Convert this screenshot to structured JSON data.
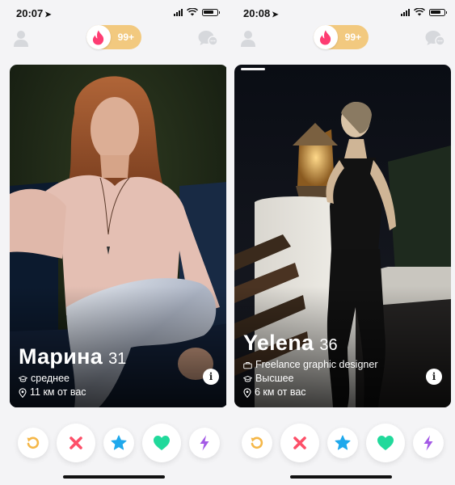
{
  "screens": [
    {
      "status_time": "20:07",
      "header": {
        "badge_count": "99+"
      },
      "card": {
        "name": "Марина",
        "age": "31",
        "details": [
          {
            "icon": "graduation-cap-icon",
            "text": "среднее"
          },
          {
            "icon": "location-pin-icon",
            "text": "11 км от вас"
          }
        ]
      }
    },
    {
      "status_time": "20:08",
      "header": {
        "badge_count": "99+"
      },
      "card": {
        "name": "Yelena",
        "age": "36",
        "details": [
          {
            "icon": "briefcase-icon",
            "text": "Freelance graphic designer"
          },
          {
            "icon": "graduation-cap-icon",
            "text": "Высшее"
          },
          {
            "icon": "location-pin-icon",
            "text": "6 км от вас"
          }
        ]
      }
    }
  ],
  "actions": [
    {
      "icon": "rewind-icon",
      "color": "#f5b748"
    },
    {
      "icon": "nope-x-icon",
      "color": "#fd4f68"
    },
    {
      "icon": "super-like-star-icon",
      "color": "#1ea8ec"
    },
    {
      "icon": "like-heart-icon",
      "color": "#21d99b"
    },
    {
      "icon": "boost-bolt-icon",
      "color": "#a45ae6"
    }
  ],
  "colors": {
    "brand_flame": "#fe3c72",
    "badge_gold": "#f2c97f",
    "header_icon_gray": "#d6d8dc"
  }
}
